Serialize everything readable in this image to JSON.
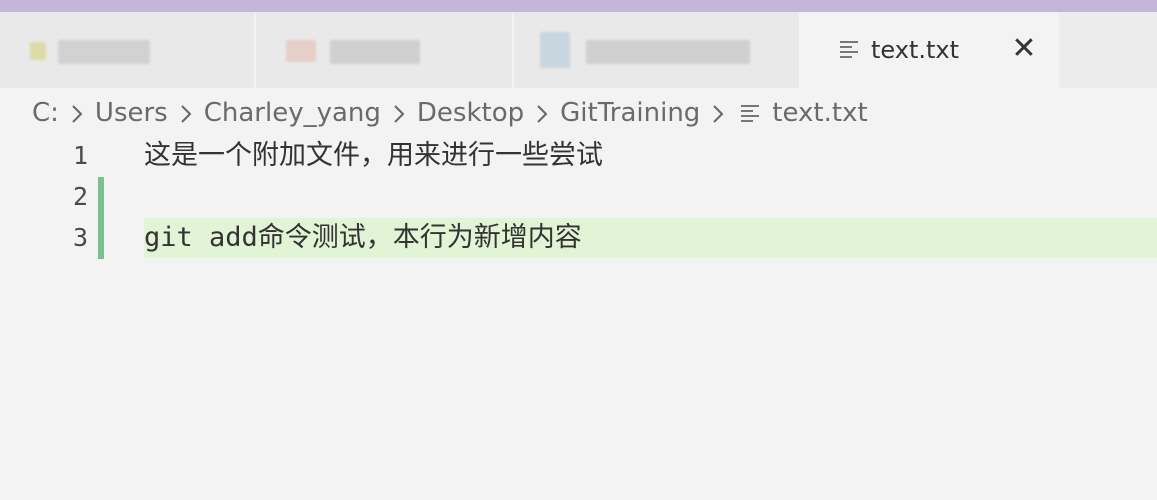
{
  "colors": {
    "accent_strip": "#c5b5d8",
    "added_line_background": "#e1f4d5",
    "gutter_added_marker": "#7cbf8e",
    "editor_background": "#f3f3f3"
  },
  "tabs": {
    "active": {
      "title": "text.txt",
      "icon": "text-file-icon",
      "close_glyph": "✕",
      "close_icon": "close-icon"
    }
  },
  "breadcrumb": {
    "separator_icon": "chevron-right-icon",
    "items": [
      "C:",
      "Users",
      "Charley_yang",
      "Desktop",
      "GitTraining"
    ],
    "file": "text.txt",
    "file_icon": "text-file-icon"
  },
  "editor": {
    "lines": [
      {
        "number": "1",
        "text": "这是一个附加文件，用来进行一些尝试"
      },
      {
        "number": "2",
        "text": ""
      },
      {
        "number": "3",
        "text": "git add命令测试，本行为新增内容"
      }
    ]
  }
}
